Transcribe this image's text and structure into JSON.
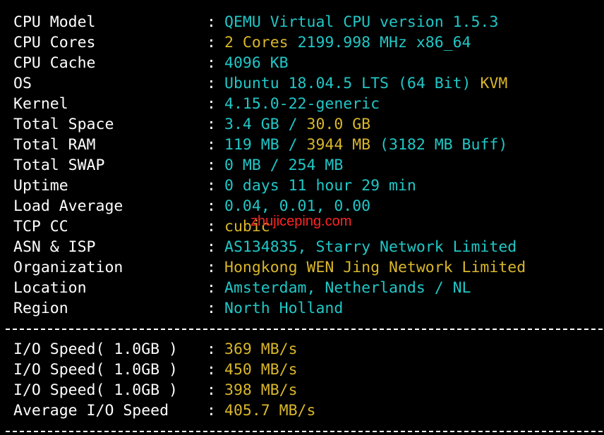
{
  "colors": {
    "background": "#000000",
    "label": "#ffffff",
    "cyan": "#21c7c7",
    "yellow": "#d9b62a",
    "watermark": "#ff2424"
  },
  "system_info": [
    {
      "label": "CPU Model",
      "separator": ":",
      "value": [
        {
          "text": "QEMU Virtual CPU version 1.5.3",
          "color": "cyan"
        }
      ]
    },
    {
      "label": "CPU Cores",
      "separator": ":",
      "value": [
        {
          "text": "2 Cores ",
          "color": "yellow"
        },
        {
          "text": "2199.998 MHz x86_64",
          "color": "cyan"
        }
      ]
    },
    {
      "label": "CPU Cache",
      "separator": ":",
      "value": [
        {
          "text": "4096 KB",
          "color": "cyan"
        }
      ]
    },
    {
      "label": "OS",
      "separator": ":",
      "value": [
        {
          "text": "Ubuntu 18.04.5 LTS (64 Bit) ",
          "color": "cyan"
        },
        {
          "text": "KVM",
          "color": "yellow"
        }
      ]
    },
    {
      "label": "Kernel",
      "separator": ":",
      "value": [
        {
          "text": "4.15.0-22-generic",
          "color": "cyan"
        }
      ]
    },
    {
      "label": "Total Space",
      "separator": ":",
      "value": [
        {
          "text": "3.4 GB / ",
          "color": "cyan"
        },
        {
          "text": "30.0 GB",
          "color": "yellow"
        }
      ]
    },
    {
      "label": "Total RAM",
      "separator": ":",
      "value": [
        {
          "text": "119 MB / ",
          "color": "cyan"
        },
        {
          "text": "3944 MB",
          "color": "yellow"
        },
        {
          "text": " (3182 MB Buff)",
          "color": "cyan"
        }
      ]
    },
    {
      "label": "Total SWAP",
      "separator": ":",
      "value": [
        {
          "text": "0 MB / 254 MB",
          "color": "cyan"
        }
      ]
    },
    {
      "label": "Uptime",
      "separator": ":",
      "value": [
        {
          "text": "0 days 11 hour 29 min",
          "color": "cyan"
        }
      ]
    },
    {
      "label": "Load Average",
      "separator": ":",
      "value": [
        {
          "text": "0.04, 0.01, 0.00",
          "color": "cyan"
        }
      ]
    },
    {
      "label": "TCP CC",
      "separator": ":",
      "value": [
        {
          "text": "cubic",
          "color": "yellow"
        }
      ]
    },
    {
      "label": "ASN & ISP",
      "separator": ":",
      "value": [
        {
          "text": "AS134835, Starry Network Limited",
          "color": "cyan"
        }
      ]
    },
    {
      "label": "Organization",
      "separator": ":",
      "value": [
        {
          "text": "Hongkong WEN Jing Network Limited",
          "color": "yellow"
        }
      ]
    },
    {
      "label": "Location",
      "separator": ":",
      "value": [
        {
          "text": "Amsterdam, Netherlands / NL",
          "color": "cyan"
        }
      ]
    },
    {
      "label": "Region",
      "separator": ":",
      "value": [
        {
          "text": "North Holland",
          "color": "cyan"
        }
      ]
    }
  ],
  "io_speed": [
    {
      "label": "I/O Speed( 1.0GB )",
      "separator": ":",
      "value": [
        {
          "text": "369 MB/s",
          "color": "yellow"
        }
      ]
    },
    {
      "label": "I/O Speed( 1.0GB )",
      "separator": ":",
      "value": [
        {
          "text": "450 MB/s",
          "color": "yellow"
        }
      ]
    },
    {
      "label": "I/O Speed( 1.0GB )",
      "separator": ":",
      "value": [
        {
          "text": "398 MB/s",
          "color": "yellow"
        }
      ]
    },
    {
      "label": "Average I/O Speed",
      "separator": ":",
      "value": [
        {
          "text": "405.7 MB/s",
          "color": "yellow"
        }
      ]
    }
  ],
  "watermark": "zhujiceping.com"
}
